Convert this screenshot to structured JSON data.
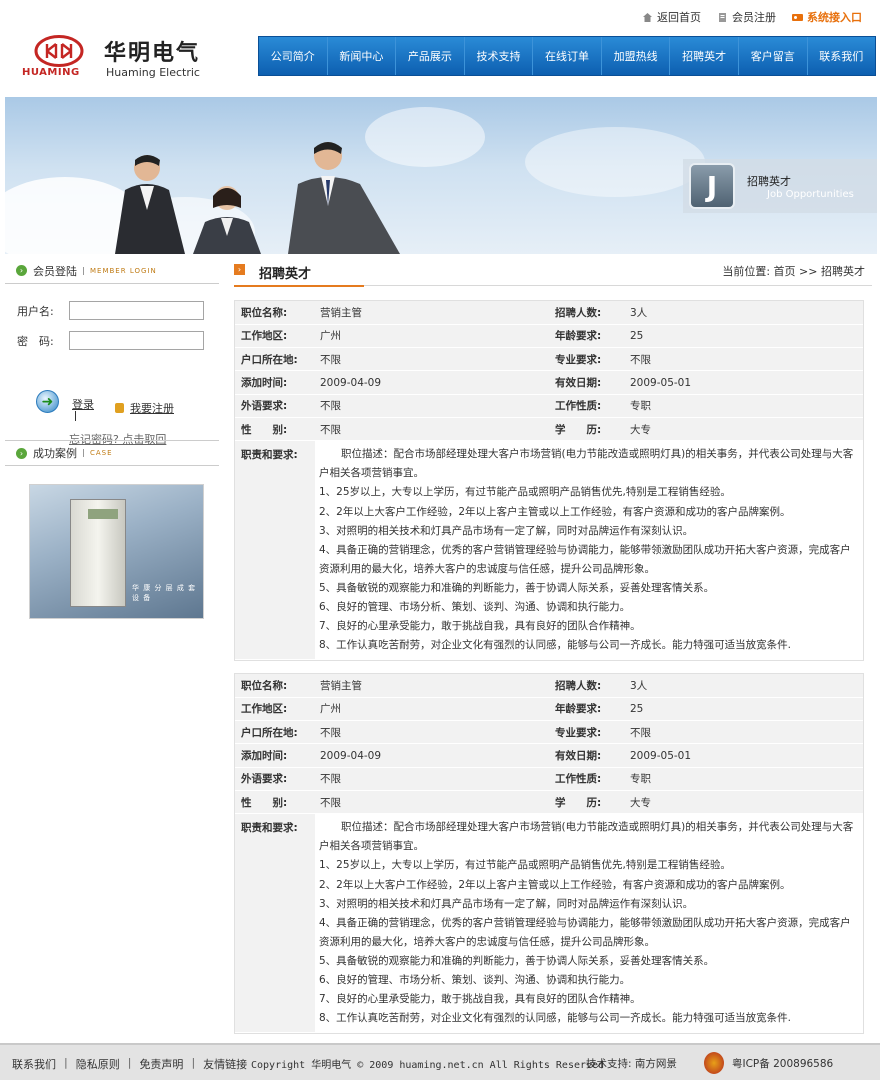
{
  "toplinks": {
    "home": "返回首页",
    "register": "会员注册",
    "system": "系统接入口"
  },
  "logo": {
    "en_small": "HUAMING",
    "cn": "华明电气",
    "en": "Huaming Electric"
  },
  "nav": [
    "公司简介",
    "新闻中心",
    "产品展示",
    "技术支持",
    "在线订单",
    "加盟热线",
    "招聘英才",
    "客户留言",
    "联系我们"
  ],
  "banner": {
    "title": "招聘英才",
    "subtitle": "Job Opportunities",
    "letter": "J"
  },
  "login": {
    "title": "会员登陆",
    "sub": "MEMBER LOGIN",
    "user_label": "用户名:",
    "pass_label": "密　码:",
    "login": "登录",
    "register": "我要注册",
    "forgot": "忘记密码? 点击取回"
  },
  "cases": {
    "title": "成功案例",
    "sub": "CASE",
    "caption": "华 康 分 层 成 套 设 备"
  },
  "main": {
    "title": "招聘英才",
    "crumb": "当前位置: 首页 >> 招聘英才"
  },
  "jobs": [
    {
      "labels": {
        "name": "职位名称:",
        "count": "招聘人数:",
        "area": "工作地区:",
        "age": "年龄要求:",
        "hukou": "户口所在地:",
        "major": "专业要求:",
        "added": "添加时间:",
        "valid": "有效日期:",
        "lang": "外语要求:",
        "nature": "工作性质:",
        "sex": "性　　别:",
        "edu": "学　　历:",
        "duty": "职责和要求:"
      },
      "name": "营销主管",
      "count": "3人",
      "area": "广州",
      "age": "25",
      "hukou": "不限",
      "major": "不限",
      "added": "2009-04-09",
      "valid": "2009-05-01",
      "lang": "不限",
      "nature": "专职",
      "sex": "不限",
      "edu": "大专",
      "desc": [
        "职位描述：配合市场部经理处理大客户市场营销(电力节能改造或照明灯具)的相关事务，并代表公司处理与大客户相关各项营销事宜。",
        "1、25岁以上，大专以上学历，有过节能产品或照明产品销售优先,特别是工程销售经验。",
        "2、2年以上大客户工作经验，2年以上客户主管或以上工作经验，有客户资源和成功的客户品牌案例。",
        "3、对照明的相关技术和灯具产品市场有一定了解，同时对品牌运作有深刻认识。",
        "4、具备正确的营销理念，优秀的客户营销管理经验与协调能力，能够带领激励团队成功开拓大客户资源，完成客户资源利用的最大化，培养大客户的忠诚度与信任感，提升公司品牌形象。",
        "5、具备敏锐的观察能力和准确的判断能力，善于协调人际关系，妥善处理客情关系。",
        "6、良好的管理、市场分析、策划、谈判、沟通、协调和执行能力。",
        "7、良好的心里承受能力，敢于挑战自我，具有良好的团队合作精神。",
        "8、工作认真吃苦耐劳，对企业文化有强烈的认同感，能够与公司一齐成长。能力特强可适当放宽条件."
      ]
    },
    {
      "labels": {
        "name": "职位名称:",
        "count": "招聘人数:",
        "area": "工作地区:",
        "age": "年龄要求:",
        "hukou": "户口所在地:",
        "major": "专业要求:",
        "added": "添加时间:",
        "valid": "有效日期:",
        "lang": "外语要求:",
        "nature": "工作性质:",
        "sex": "性　　别:",
        "edu": "学　　历:",
        "duty": "职责和要求:"
      },
      "name": "营销主管",
      "count": "3人",
      "area": "广州",
      "age": "25",
      "hukou": "不限",
      "major": "不限",
      "added": "2009-04-09",
      "valid": "2009-05-01",
      "lang": "不限",
      "nature": "专职",
      "sex": "不限",
      "edu": "大专",
      "desc": [
        "职位描述：配合市场部经理处理大客户市场营销(电力节能改造或照明灯具)的相关事务，并代表公司处理与大客户相关各项营销事宜。",
        "1、25岁以上，大专以上学历，有过节能产品或照明产品销售优先,特别是工程销售经验。",
        "2、2年以上大客户工作经验，2年以上客户主管或以上工作经验，有客户资源和成功的客户品牌案例。",
        "3、对照明的相关技术和灯具产品市场有一定了解，同时对品牌运作有深刻认识。",
        "4、具备正确的营销理念，优秀的客户营销管理经验与协调能力，能够带领激励团队成功开拓大客户资源，完成客户资源利用的最大化，培养大客户的忠诚度与信任感，提升公司品牌形象。",
        "5、具备敏锐的观察能力和准确的判断能力，善于协调人际关系，妥善处理客情关系。",
        "6、良好的管理、市场分析、策划、谈判、沟通、协调和执行能力。",
        "7、良好的心里承受能力，敢于挑战自我，具有良好的团队合作精神。",
        "8、工作认真吃苦耐劳，对企业文化有强烈的认同感，能够与公司一齐成长。能力特强可适当放宽条件."
      ]
    }
  ],
  "footer": {
    "links": [
      "联系我们",
      "隐私原则",
      "免责声明",
      "友情链接"
    ],
    "copyright": "Copyright 华明电气 © 2009 huaming.net.cn All Rights Reserved",
    "tech": "技术支持: 南方网景",
    "icp": "粤ICP备 200896586"
  },
  "colors": {
    "nav": "#1a73c4",
    "accent": "#e57b1f",
    "system_link": "#e8700c",
    "logo_red": "#c42623"
  }
}
